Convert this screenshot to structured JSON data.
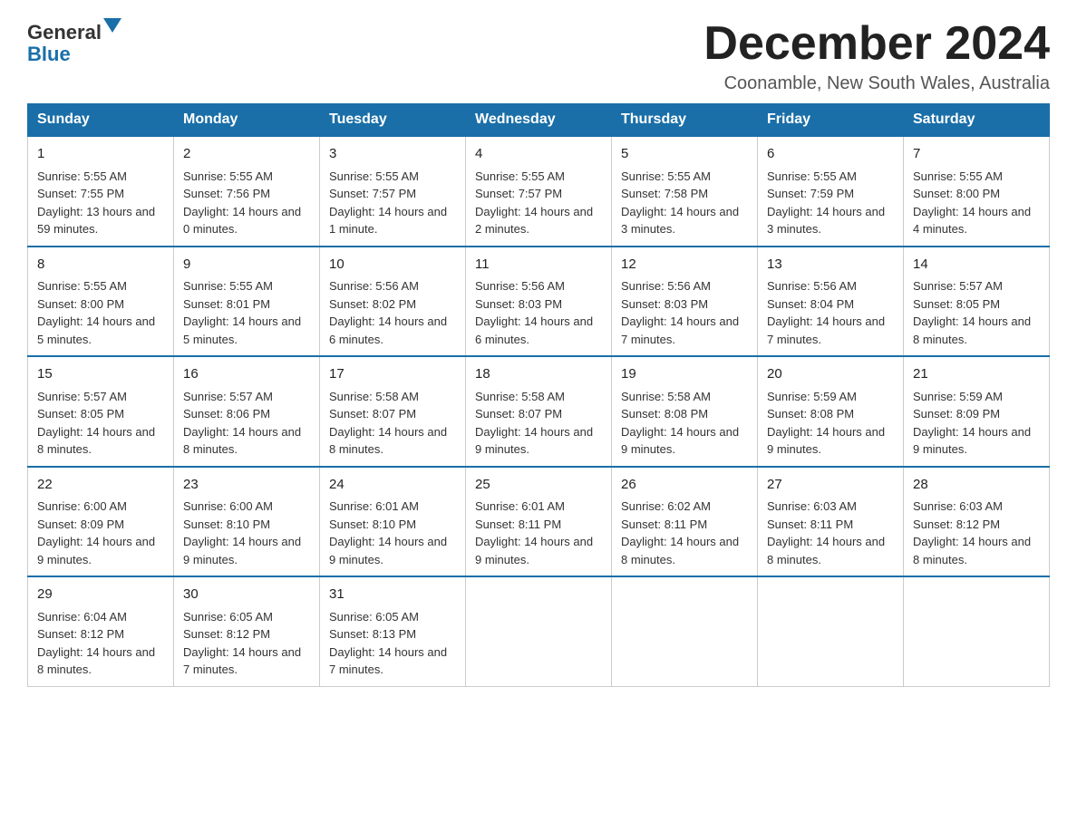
{
  "header": {
    "logo_text": "General",
    "logo_blue": "Blue",
    "month_title": "December 2024",
    "location": "Coonamble, New South Wales, Australia"
  },
  "days_of_week": [
    "Sunday",
    "Monday",
    "Tuesday",
    "Wednesday",
    "Thursday",
    "Friday",
    "Saturday"
  ],
  "weeks": [
    [
      {
        "day": "1",
        "sunrise": "5:55 AM",
        "sunset": "7:55 PM",
        "daylight": "13 hours and 59 minutes."
      },
      {
        "day": "2",
        "sunrise": "5:55 AM",
        "sunset": "7:56 PM",
        "daylight": "14 hours and 0 minutes."
      },
      {
        "day": "3",
        "sunrise": "5:55 AM",
        "sunset": "7:57 PM",
        "daylight": "14 hours and 1 minute."
      },
      {
        "day": "4",
        "sunrise": "5:55 AM",
        "sunset": "7:57 PM",
        "daylight": "14 hours and 2 minutes."
      },
      {
        "day": "5",
        "sunrise": "5:55 AM",
        "sunset": "7:58 PM",
        "daylight": "14 hours and 3 minutes."
      },
      {
        "day": "6",
        "sunrise": "5:55 AM",
        "sunset": "7:59 PM",
        "daylight": "14 hours and 3 minutes."
      },
      {
        "day": "7",
        "sunrise": "5:55 AM",
        "sunset": "8:00 PM",
        "daylight": "14 hours and 4 minutes."
      }
    ],
    [
      {
        "day": "8",
        "sunrise": "5:55 AM",
        "sunset": "8:00 PM",
        "daylight": "14 hours and 5 minutes."
      },
      {
        "day": "9",
        "sunrise": "5:55 AM",
        "sunset": "8:01 PM",
        "daylight": "14 hours and 5 minutes."
      },
      {
        "day": "10",
        "sunrise": "5:56 AM",
        "sunset": "8:02 PM",
        "daylight": "14 hours and 6 minutes."
      },
      {
        "day": "11",
        "sunrise": "5:56 AM",
        "sunset": "8:03 PM",
        "daylight": "14 hours and 6 minutes."
      },
      {
        "day": "12",
        "sunrise": "5:56 AM",
        "sunset": "8:03 PM",
        "daylight": "14 hours and 7 minutes."
      },
      {
        "day": "13",
        "sunrise": "5:56 AM",
        "sunset": "8:04 PM",
        "daylight": "14 hours and 7 minutes."
      },
      {
        "day": "14",
        "sunrise": "5:57 AM",
        "sunset": "8:05 PM",
        "daylight": "14 hours and 8 minutes."
      }
    ],
    [
      {
        "day": "15",
        "sunrise": "5:57 AM",
        "sunset": "8:05 PM",
        "daylight": "14 hours and 8 minutes."
      },
      {
        "day": "16",
        "sunrise": "5:57 AM",
        "sunset": "8:06 PM",
        "daylight": "14 hours and 8 minutes."
      },
      {
        "day": "17",
        "sunrise": "5:58 AM",
        "sunset": "8:07 PM",
        "daylight": "14 hours and 8 minutes."
      },
      {
        "day": "18",
        "sunrise": "5:58 AM",
        "sunset": "8:07 PM",
        "daylight": "14 hours and 9 minutes."
      },
      {
        "day": "19",
        "sunrise": "5:58 AM",
        "sunset": "8:08 PM",
        "daylight": "14 hours and 9 minutes."
      },
      {
        "day": "20",
        "sunrise": "5:59 AM",
        "sunset": "8:08 PM",
        "daylight": "14 hours and 9 minutes."
      },
      {
        "day": "21",
        "sunrise": "5:59 AM",
        "sunset": "8:09 PM",
        "daylight": "14 hours and 9 minutes."
      }
    ],
    [
      {
        "day": "22",
        "sunrise": "6:00 AM",
        "sunset": "8:09 PM",
        "daylight": "14 hours and 9 minutes."
      },
      {
        "day": "23",
        "sunrise": "6:00 AM",
        "sunset": "8:10 PM",
        "daylight": "14 hours and 9 minutes."
      },
      {
        "day": "24",
        "sunrise": "6:01 AM",
        "sunset": "8:10 PM",
        "daylight": "14 hours and 9 minutes."
      },
      {
        "day": "25",
        "sunrise": "6:01 AM",
        "sunset": "8:11 PM",
        "daylight": "14 hours and 9 minutes."
      },
      {
        "day": "26",
        "sunrise": "6:02 AM",
        "sunset": "8:11 PM",
        "daylight": "14 hours and 8 minutes."
      },
      {
        "day": "27",
        "sunrise": "6:03 AM",
        "sunset": "8:11 PM",
        "daylight": "14 hours and 8 minutes."
      },
      {
        "day": "28",
        "sunrise": "6:03 AM",
        "sunset": "8:12 PM",
        "daylight": "14 hours and 8 minutes."
      }
    ],
    [
      {
        "day": "29",
        "sunrise": "6:04 AM",
        "sunset": "8:12 PM",
        "daylight": "14 hours and 8 minutes."
      },
      {
        "day": "30",
        "sunrise": "6:05 AM",
        "sunset": "8:12 PM",
        "daylight": "14 hours and 7 minutes."
      },
      {
        "day": "31",
        "sunrise": "6:05 AM",
        "sunset": "8:13 PM",
        "daylight": "14 hours and 7 minutes."
      },
      null,
      null,
      null,
      null
    ]
  ]
}
